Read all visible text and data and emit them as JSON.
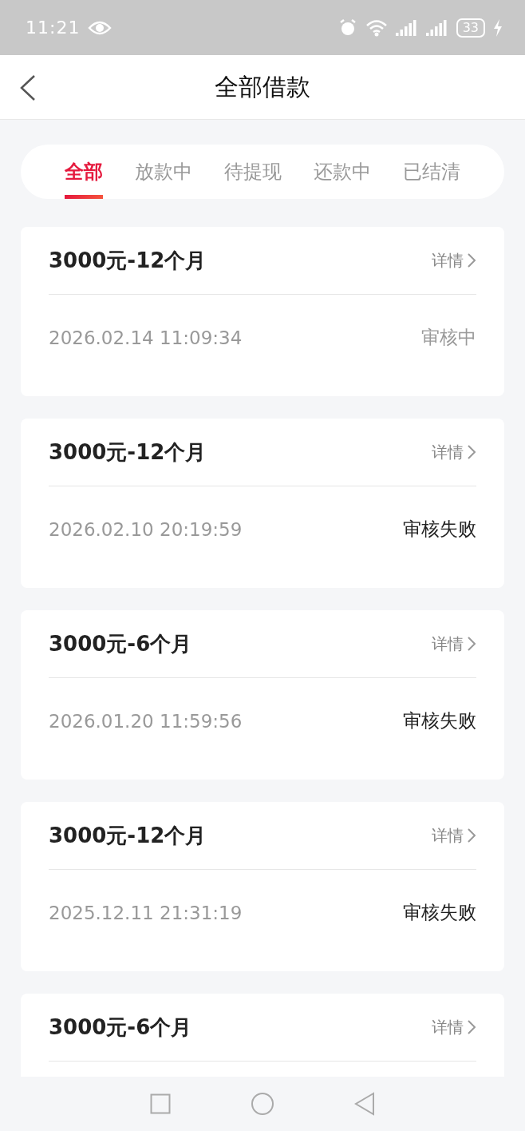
{
  "status_bar": {
    "time": "11:21",
    "battery": "33"
  },
  "header": {
    "title": "全部借款"
  },
  "tabs": [
    {
      "label": "全部",
      "selected": true
    },
    {
      "label": "放款中",
      "selected": false
    },
    {
      "label": "待提现",
      "selected": false
    },
    {
      "label": "还款中",
      "selected": false
    },
    {
      "label": "已结清",
      "selected": false
    }
  ],
  "loans": [
    {
      "title": "3000元-12个月",
      "detail": "详情",
      "date": "2026.02.14 11:09:34",
      "status": "审核中",
      "kind": "pending"
    },
    {
      "title": "3000元-12个月",
      "detail": "详情",
      "date": "2026.02.10 20:19:59",
      "status": "审核失败",
      "kind": "failed"
    },
    {
      "title": "3000元-6个月",
      "detail": "详情",
      "date": "2026.01.20 11:59:56",
      "status": "审核失败",
      "kind": "failed"
    },
    {
      "title": "3000元-12个月",
      "detail": "详情",
      "date": "2025.12.11 21:31:19",
      "status": "审核失败",
      "kind": "failed"
    },
    {
      "title": "3000元-6个月",
      "detail": "详情"
    }
  ]
}
